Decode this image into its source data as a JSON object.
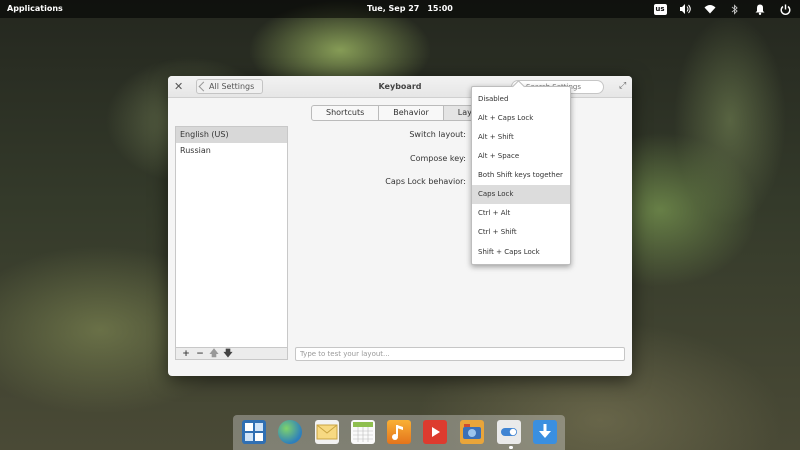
{
  "panel": {
    "applications": "Applications",
    "date": "Tue, Sep 27",
    "time": "15:00",
    "keyboard_indicator": "us",
    "tray_icons": [
      "keyboard-layout-icon",
      "volume-icon",
      "wifi-icon",
      "bluetooth-icon",
      "notifications-bell-icon",
      "power-icon"
    ]
  },
  "window": {
    "title": "Keyboard",
    "back_label": "All Settings",
    "search_placeholder": "Search Settings",
    "tabs": [
      {
        "label": "Shortcuts"
      },
      {
        "label": "Behavior"
      },
      {
        "label": "Layout",
        "active": true
      }
    ],
    "layouts": [
      {
        "label": "English (US)",
        "selected": true
      },
      {
        "label": "Russian",
        "selected": false
      }
    ],
    "list_toolbar": [
      "+",
      "−",
      "🡅",
      "🡇"
    ],
    "options": {
      "switch_layout": "Switch layout:",
      "compose_key": "Compose key:",
      "caps_lock_behavior": "Caps Lock behavior:"
    },
    "test_placeholder": "Type to test your layout..."
  },
  "dropdown": {
    "items": [
      {
        "label": "Disabled"
      },
      {
        "label": "Alt + Caps Lock"
      },
      {
        "label": "Alt + Shift"
      },
      {
        "label": "Alt + Space"
      },
      {
        "label": "Both Shift keys together"
      },
      {
        "label": "Caps Lock",
        "selected": true
      },
      {
        "label": "Ctrl + Alt"
      },
      {
        "label": "Ctrl + Shift"
      },
      {
        "label": "Shift + Caps Lock"
      }
    ]
  },
  "dock": {
    "apps": [
      "multitasking-view-icon",
      "web-browser-icon",
      "mail-icon",
      "calendar-icon",
      "music-icon",
      "videos-icon",
      "photos-icon",
      "system-settings-icon",
      "appcenter-icon"
    ]
  }
}
